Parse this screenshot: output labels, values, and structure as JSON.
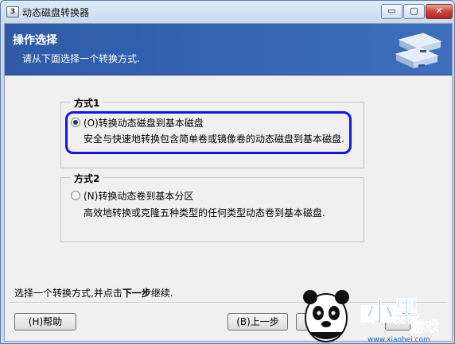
{
  "window": {
    "title": "动态磁盘转换器",
    "app_icon_glyph": "3",
    "controls": {
      "minimize": "▭",
      "maximize": "▢",
      "close": "✕"
    }
  },
  "header": {
    "title": "操作选择",
    "subtitle": "请从下面选择一个转换方式."
  },
  "options": [
    {
      "group_label": "方式1",
      "label": "(O)转换动态磁盘到基本磁盘",
      "description": "安全与快速地转换包含简单卷或镜像卷的动态磁盘到基本磁盘.",
      "selected": true
    },
    {
      "group_label": "方式2",
      "label": "(N)转换动态卷到基本分区",
      "description": "高效地转换或克隆五种类型的任何类型动态卷到基本磁盘.",
      "selected": false
    }
  ],
  "instruction": {
    "prefix": "选择一个转换方式,并点击",
    "bold": "下一步",
    "suffix": "继续."
  },
  "buttons": {
    "help": "(H)帮助",
    "back": "(B)上一步"
  },
  "watermark": {
    "text_main": "小黑",
    "text_sub": "游戏",
    "url": "www.xiaohei.com"
  },
  "colors": {
    "header_blue": "#3767b5",
    "focus_ring": "#1414e8",
    "close_red": "#c9463a"
  }
}
